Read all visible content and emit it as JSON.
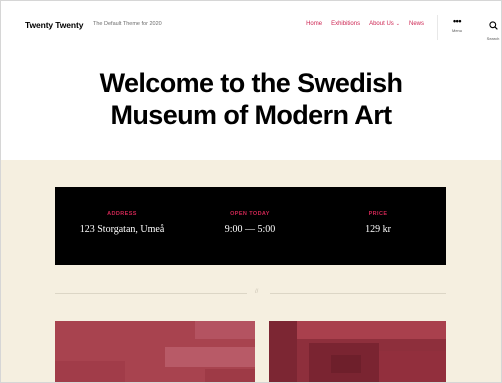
{
  "header": {
    "site_title": "Twenty Twenty",
    "site_description": "The Default Theme for 2020",
    "nav": [
      {
        "label": "Home"
      },
      {
        "label": "Exhibitions"
      },
      {
        "label": "About Us",
        "has_submenu": true
      },
      {
        "label": "News"
      }
    ],
    "menu_label": "Menu",
    "search_label": "Search"
  },
  "hero": {
    "title": "Welcome to the Swedish Museum of Modern Art"
  },
  "info": {
    "address_label": "ADDRESS",
    "address_value": "123 Storgatan, Umeå",
    "open_label": "OPEN TODAY",
    "open_value": "9:00 — 5:00",
    "price_label": "PRICE",
    "price_value": "129 kr"
  },
  "colors": {
    "accent": "#cd2653",
    "background": "#f5efe0",
    "infobox": "#000000",
    "image_primary": "#a8434f"
  },
  "icons": [
    "menu-dots-icon",
    "search-icon",
    "chevron-down-icon"
  ]
}
